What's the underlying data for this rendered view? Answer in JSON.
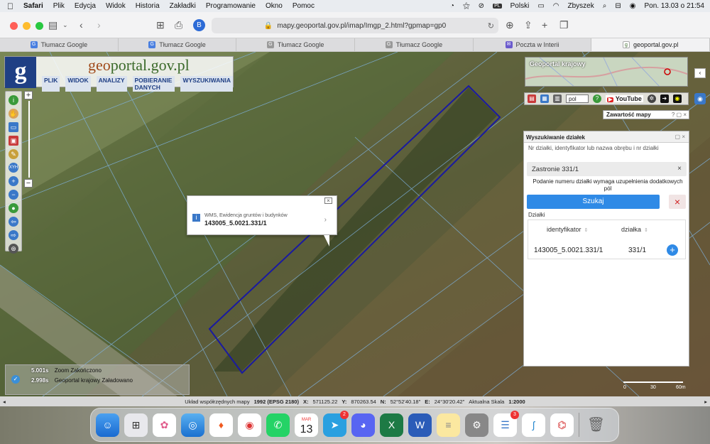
{
  "menubar": {
    "app": "Safari",
    "items": [
      "Plik",
      "Edycja",
      "Widok",
      "Historia",
      "Zakładki",
      "Programowanie",
      "Okno",
      "Pomoc"
    ],
    "language": "Polski",
    "user": "Zbyszek",
    "datetime": "Pon. 13.03 o  21:54",
    "keyboard_badge": "PL"
  },
  "browser": {
    "url": "mapy.geoportal.gov.pl/imap/Imgp_2.html?gpmap=gp0",
    "tabs": [
      {
        "label": "Tłumacz Google"
      },
      {
        "label": "Tłumacz Google"
      },
      {
        "label": "Tłumacz Google"
      },
      {
        "label": "Tłumacz Google"
      },
      {
        "label": "Poczta w Interii"
      },
      {
        "label": "geoportal.gov.pl"
      }
    ],
    "active_tab_index": 5
  },
  "geoportal": {
    "logo_letter": "g",
    "logo_geo": "geo",
    "logo_rest": "portal.gov.pl",
    "menu": [
      "PLIK",
      "WIDOK",
      "ANALIZY",
      "POBIERANIE DANYCH",
      "WYSZUKIWANIA"
    ]
  },
  "popup": {
    "source": "WMS, Ewidencja gruntów i budynków",
    "id": "143005_5.0021.331/1",
    "info_glyph": "i",
    "arrow_glyph": "›",
    "close_glyph": "×"
  },
  "overview": {
    "title": "Geoportal krajowy"
  },
  "iconrow": {
    "language_select": "pol",
    "youtube_label": "YouTube"
  },
  "content_panel": {
    "title": "Zawartość mapy",
    "controls": "? ▢ ×"
  },
  "search": {
    "title": "Wyszukiwanie działek",
    "controls": "▢ ×",
    "hint": "Nr działki, identyfikator lub nazwa obrębu i nr działki",
    "value": "Zastronie 331/1",
    "clear_glyph": "×",
    "note": "Podanie numeru działki wymaga uzupełnienia dodatkowych pól",
    "button": "Szukaj",
    "cancel_glyph": "×",
    "results_label": "Działki",
    "columns": [
      "identyfikator",
      "działka"
    ],
    "sort_glyph": "⇕",
    "rows": [
      {
        "identyfikator": "143005_5.0021.331/1",
        "dzialka": "331/1"
      }
    ],
    "add_glyph": "+"
  },
  "status": {
    "rows": [
      {
        "time": "5.001s",
        "label": "Zoom",
        "state": "Zakończono"
      },
      {
        "time": "2.998s",
        "label": "Geoportal krajowy",
        "state": "Załadowano"
      }
    ],
    "check_glyph": "✓"
  },
  "scale": {
    "labels": [
      "0",
      "30",
      "60m"
    ]
  },
  "coords": {
    "label": "Układ współrzędnych mapy",
    "crs": "1992 (EPSG 2180)",
    "x_label": "X:",
    "x": "571125.22",
    "y_label": "Y:",
    "y": "870263.54",
    "n_label": "N:",
    "n": "52°52'40.18\"",
    "e_label": "E:",
    "e": "24°30'20.42\"",
    "scale_label": "Aktualna Skala",
    "scale": "1:2000"
  },
  "dock": {
    "calendar_month": "MAR",
    "calendar_day": "13",
    "telegram_badge": "2",
    "reminders_badge": "3"
  },
  "colors": {
    "parcel_outline": "#1a1aa0",
    "accent": "#2f8ae6"
  }
}
